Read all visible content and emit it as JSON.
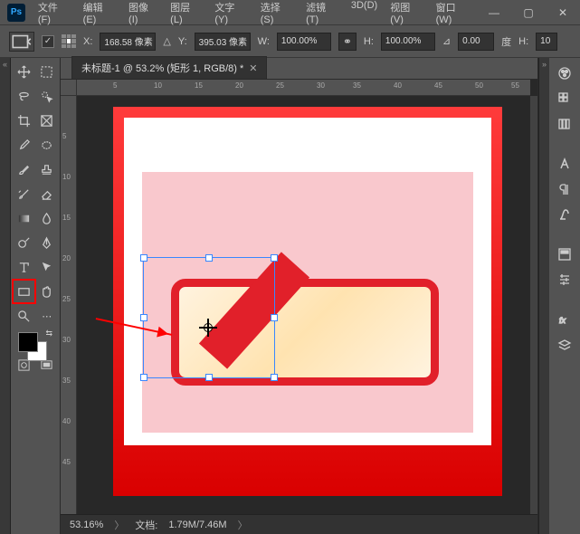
{
  "logo": "Ps",
  "menu": [
    "文件(F)",
    "编辑(E)",
    "图像(I)",
    "图层(L)",
    "文字(Y)",
    "选择(S)",
    "滤镜(T)",
    "3D(D)",
    "视图(V)",
    "窗口(W)"
  ],
  "winctrl": {
    "min": "—",
    "max": "▢",
    "close": "✕"
  },
  "options": {
    "X_lbl": "X:",
    "X_val": "168.58 像素",
    "Y_lbl": "Y:",
    "Y_val": "395.03 像素",
    "W_lbl": "W:",
    "W_val": "100.00%",
    "H_lbl": "H:",
    "H_val": "100.00%",
    "angle_val": "0.00",
    "angle_unit": "度",
    "Hskew_lbl": "H:",
    "Hskew_val": "10"
  },
  "tab": {
    "title": "未标题-1 @ 53.2% (矩形 1, RGB/8) *"
  },
  "ruler_h": [
    "5",
    "10",
    "15",
    "20",
    "25",
    "30",
    "35",
    "40",
    "45",
    "50",
    "55"
  ],
  "ruler_v": [
    "5",
    "10",
    "15",
    "20",
    "25",
    "30",
    "35",
    "40",
    "45"
  ],
  "status": {
    "zoom": "53.16%",
    "doc_lbl": "文档:",
    "doc_val": "1.79M/7.46M"
  }
}
